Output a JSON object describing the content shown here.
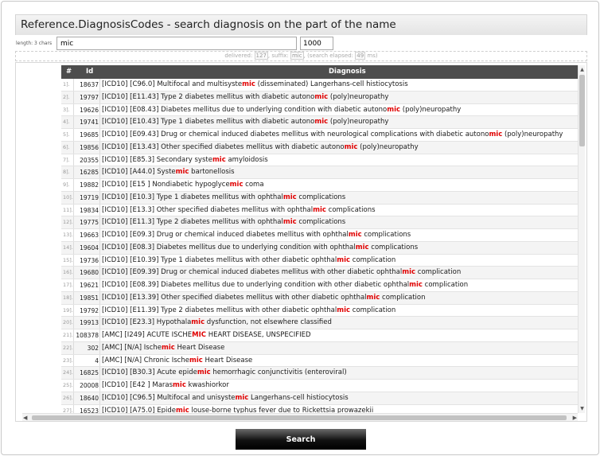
{
  "title": "Reference.DiagnosisCodes - search diagnosis on the part of the name",
  "search": {
    "length_label": "length: 3 chars",
    "query": "mic",
    "limit": "1000"
  },
  "status": {
    "delivered_label": "delivered:",
    "delivered": "127",
    "suffix_label": "suffix:",
    "suffix": "mic",
    "elapsed_label": "(search elapsed:",
    "elapsed": "49",
    "elapsed_unit": "ms)"
  },
  "table": {
    "columns": [
      "#",
      "Id",
      "Diagnosis"
    ],
    "rows": [
      {
        "n": "1].",
        "id": "18637",
        "pre": "[ICD10] [C96.0] Multifocal and multisyste",
        "hl": "mic",
        "post": " (disseminated) Langerhans-cell histiocytosis"
      },
      {
        "n": "2].",
        "id": "19797",
        "pre": "[ICD10] [E11.43] Type 2 diabetes mellitus with diabetic autono",
        "hl": "mic",
        "post": " (poly)neuropathy"
      },
      {
        "n": "3].",
        "id": "19626",
        "pre": "[ICD10] [E08.43] Diabetes mellitus due to underlying condition with diabetic autono",
        "hl": "mic",
        "post": " (poly)neuropathy"
      },
      {
        "n": "4].",
        "id": "19741",
        "pre": "[ICD10] [E10.43] Type 1 diabetes mellitus with diabetic autono",
        "hl": "mic",
        "post": " (poly)neuropathy"
      },
      {
        "n": "5].",
        "id": "19685",
        "pre": "[ICD10] [E09.43] Drug or chemical induced diabetes mellitus with neurological complications with diabetic autono",
        "hl": "mic",
        "post": " (poly)neuropathy"
      },
      {
        "n": "6].",
        "id": "19856",
        "pre": "[ICD10] [E13.43] Other specified diabetes mellitus with diabetic autono",
        "hl": "mic",
        "post": " (poly)neuropathy"
      },
      {
        "n": "7].",
        "id": "20355",
        "pre": "[ICD10] [E85.3] Secondary syste",
        "hl": "mic",
        "post": " amyloidosis"
      },
      {
        "n": "8].",
        "id": "16285",
        "pre": "[ICD10] [A44.0] Syste",
        "hl": "mic",
        "post": " bartonellosis"
      },
      {
        "n": "9].",
        "id": "19882",
        "pre": "[ICD10] [E15 ] Nondiabetic hypoglyce",
        "hl": "mic",
        "post": " coma"
      },
      {
        "n": "10].",
        "id": "19719",
        "pre": "[ICD10] [E10.3] Type 1 diabetes mellitus with ophthal",
        "hl": "mic",
        "post": " complications"
      },
      {
        "n": "11].",
        "id": "19834",
        "pre": "[ICD10] [E13.3] Other specified diabetes mellitus with ophthal",
        "hl": "mic",
        "post": " complications"
      },
      {
        "n": "12].",
        "id": "19775",
        "pre": "[ICD10] [E11.3] Type 2 diabetes mellitus with ophthal",
        "hl": "mic",
        "post": " complications"
      },
      {
        "n": "13].",
        "id": "19663",
        "pre": "[ICD10] [E09.3] Drug or chemical induced diabetes mellitus with ophthal",
        "hl": "mic",
        "post": " complications"
      },
      {
        "n": "14].",
        "id": "19604",
        "pre": "[ICD10] [E08.3] Diabetes mellitus due to underlying condition with ophthal",
        "hl": "mic",
        "post": " complications"
      },
      {
        "n": "15].",
        "id": "19736",
        "pre": "[ICD10] [E10.39] Type 1 diabetes mellitus with other diabetic ophthal",
        "hl": "mic",
        "post": " complication"
      },
      {
        "n": "16].",
        "id": "19680",
        "pre": "[ICD10] [E09.39] Drug or chemical induced diabetes mellitus with other diabetic ophthal",
        "hl": "mic",
        "post": " complication"
      },
      {
        "n": "17].",
        "id": "19621",
        "pre": "[ICD10] [E08.39] Diabetes mellitus due to underlying condition with other diabetic ophthal",
        "hl": "mic",
        "post": " complication"
      },
      {
        "n": "18].",
        "id": "19851",
        "pre": "[ICD10] [E13.39] Other specified diabetes mellitus with other diabetic ophthal",
        "hl": "mic",
        "post": " complication"
      },
      {
        "n": "19].",
        "id": "19792",
        "pre": "[ICD10] [E11.39] Type 2 diabetes mellitus with other diabetic ophthal",
        "hl": "mic",
        "post": " complication"
      },
      {
        "n": "20].",
        "id": "19913",
        "pre": "[ICD10] [E23.3] Hypothala",
        "hl": "mic",
        "post": " dysfunction, not elsewhere classified"
      },
      {
        "n": "21].",
        "id": "108378",
        "pre": "[AMC] [I249] ACUTE ISCHE",
        "hl": "MIC",
        "post": " HEART DISEASE, UNSPECIFIED"
      },
      {
        "n": "22].",
        "id": "302",
        "pre": "[AMC] [N/A] Ische",
        "hl": "mic",
        "post": " Heart Disease"
      },
      {
        "n": "23].",
        "id": "4",
        "pre": "[AMC] [N/A] Chronic Ische",
        "hl": "mic",
        "post": " Heart Disease"
      },
      {
        "n": "24].",
        "id": "16825",
        "pre": "[ICD10] [B30.3] Acute epide",
        "hl": "mic",
        "post": " hemorrhagic conjunctivitis (enteroviral)"
      },
      {
        "n": "25].",
        "id": "20008",
        "pre": "[ICD10] [E42 ] Maras",
        "hl": "mic",
        "post": " kwashiorkor"
      },
      {
        "n": "26].",
        "id": "18640",
        "pre": "[ICD10] [C96.5] Multifocal and unisyste",
        "hl": "mic",
        "post": " Langerhans-cell histiocytosis"
      },
      {
        "n": "27].",
        "id": "16523",
        "pre": "[ICD10] [A75.0] Epide",
        "hl": "mic",
        "post": " louse-borne typhus fever due to Rickettsia prowazekii"
      }
    ]
  },
  "icons": {
    "scroll_up": "▲",
    "scroll_down": "▼",
    "scroll_left": "◀",
    "scroll_right": "▶"
  },
  "search_button": "Search"
}
